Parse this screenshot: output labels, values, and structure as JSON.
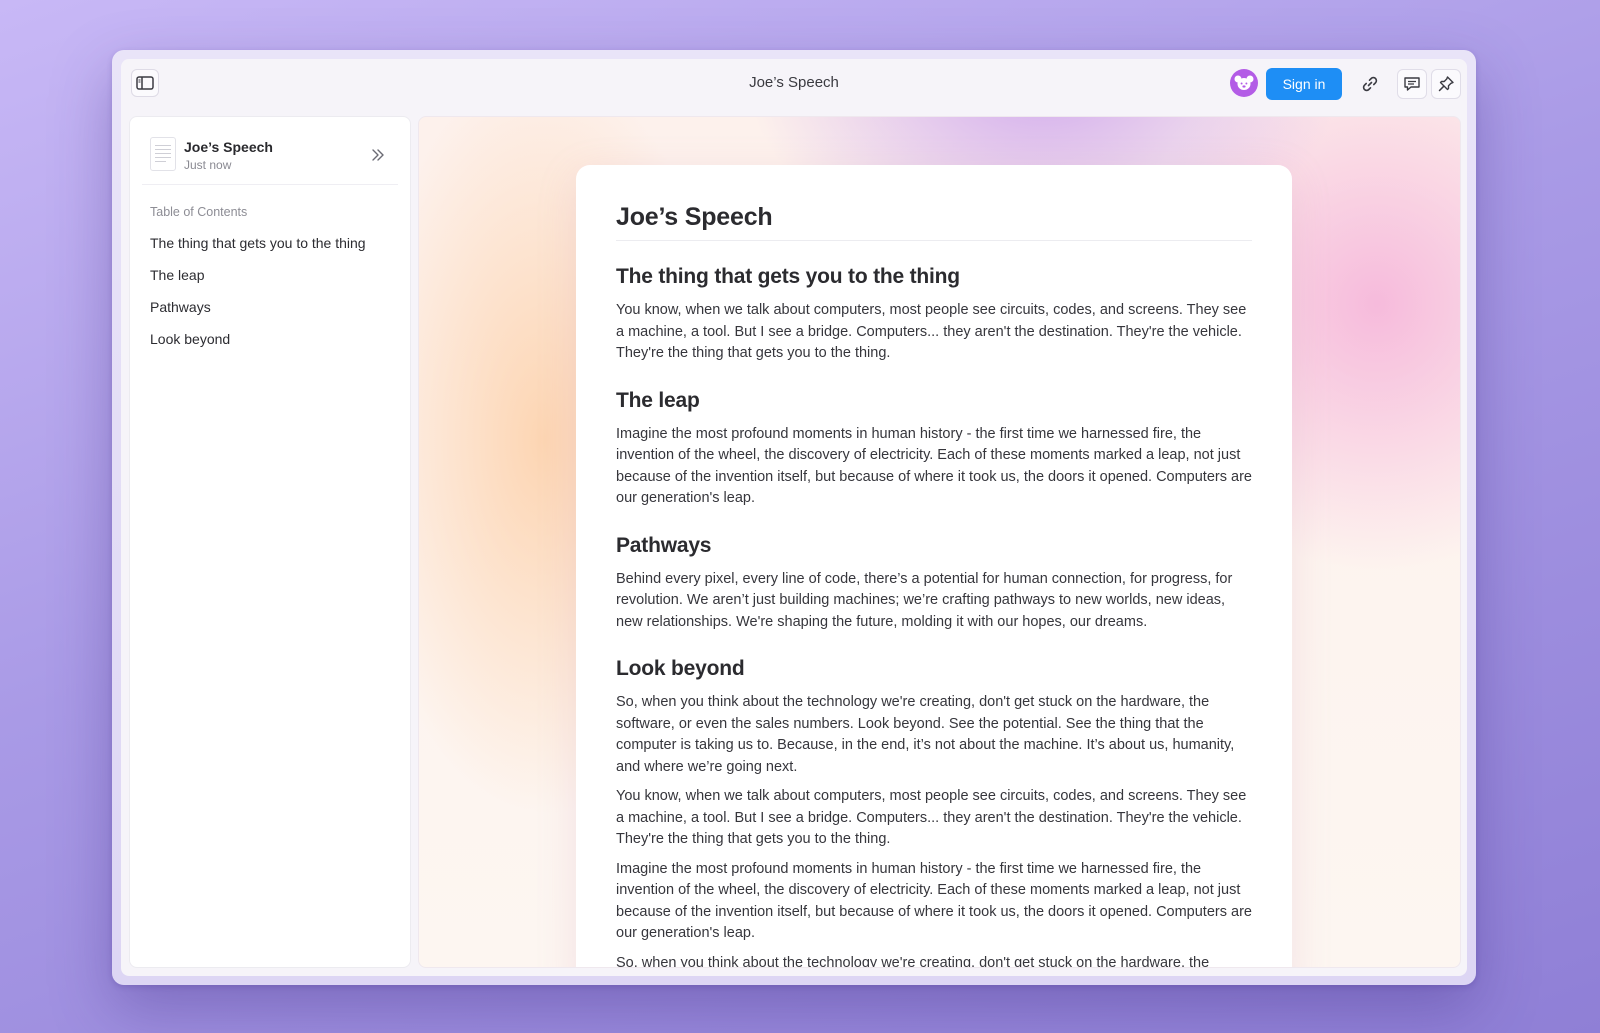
{
  "window": {
    "title": "Joe’s Speech"
  },
  "header": {
    "signin_label": "Sign in",
    "icons": [
      "sidebar-toggle-icon",
      "avatar-icon",
      "link-icon",
      "comment-icon",
      "pin-icon"
    ]
  },
  "sidebar": {
    "doc_name": "Joe’s Speech",
    "doc_time": "Just now",
    "toc_title": "Table of Contents",
    "toc": [
      {
        "label": "The thing that gets you to the thing"
      },
      {
        "label": "The leap"
      },
      {
        "label": "Pathways"
      },
      {
        "label": "Look beyond"
      }
    ]
  },
  "document": {
    "title": "Joe’s Speech",
    "sections": [
      {
        "heading": "The thing that gets you to the thing",
        "paragraphs": [
          "You know, when we talk about computers, most people see circuits, codes, and screens. They see a machine, a tool. But I see a bridge. Computers... they aren't the destination. They're the vehicle. They're the thing that gets you to the thing."
        ]
      },
      {
        "heading": "The leap",
        "paragraphs": [
          "Imagine the most profound moments in human history - the first time we harnessed fire, the invention of the wheel, the discovery of electricity. Each of these moments marked a leap, not just because of the invention itself, but because of where it took us, the doors it opened. Computers are our generation's leap."
        ]
      },
      {
        "heading": "Pathways",
        "paragraphs": [
          "Behind every pixel, every line of code, there’s a potential for human connection, for progress, for revolution. We aren’t just building machines; we’re crafting pathways to new worlds, new ideas, new relationships. We're shaping the future, molding it with our hopes, our dreams."
        ]
      },
      {
        "heading": "Look beyond",
        "paragraphs": [
          "So, when you think about the technology we're creating, don't get stuck on the hardware, the software, or even the sales numbers. Look beyond. See the potential. See the thing that the computer is taking us to. Because, in the end, it’s not about the machine. It’s about us, humanity, and where we’re going next.",
          "You know, when we talk about computers, most people see circuits, codes, and screens. They see a machine, a tool. But I see a bridge. Computers... they aren't the destination. They're the vehicle. They're the thing that gets you to the thing.",
          "Imagine the most profound moments in human history - the first time we harnessed fire, the invention of the wheel, the discovery of electricity. Each of these moments marked a leap, not just because of the invention itself, but because of where it took us, the doors it opened. Computers are our generation's leap.",
          "So, when you think about the technology we're creating, don't get stuck on the hardware, the software, or even the sales numbers. Look beyond. See the potential. See the thing that the computer is taking us to. Because, in the end, it’s not about the machine. It’s about us, humanity, and where we’re going next."
        ]
      }
    ]
  },
  "colors": {
    "accent": "#1e8ef5",
    "avatar": "#b35ce6"
  }
}
